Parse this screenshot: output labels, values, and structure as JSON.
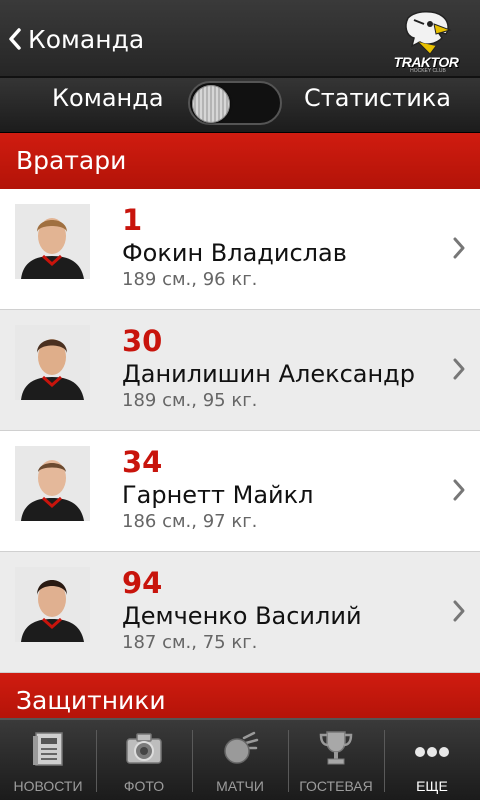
{
  "header": {
    "back_label": "Команда",
    "logo_text": "TRAKTOR",
    "logo_subtext": "HOCKEY CLUB"
  },
  "segmented": {
    "left_label": "Команда",
    "right_label": "Статистика"
  },
  "sections": [
    {
      "title": "Вратари",
      "players": [
        {
          "number": "1",
          "name": "Фокин Владислав",
          "meta": "189 см., 96 кг."
        },
        {
          "number": "30",
          "name": "Данилишин Александр",
          "meta": "189 см., 95 кг."
        },
        {
          "number": "34",
          "name": "Гарнетт Майкл",
          "meta": "186 см., 97 кг."
        },
        {
          "number": "94",
          "name": "Демченко Василий",
          "meta": "187 см., 75 кг."
        }
      ]
    },
    {
      "title": "Защитники"
    }
  ],
  "tabbar": {
    "tabs": [
      {
        "label": "НОВОСТИ",
        "icon": "newspaper-icon"
      },
      {
        "label": "ФОТО",
        "icon": "camera-icon"
      },
      {
        "label": "МАТЧИ",
        "icon": "puck-icon"
      },
      {
        "label": "ГОСТЕВАЯ",
        "icon": "trophy-icon"
      },
      {
        "label": "ЕЩЕ",
        "icon": "more-icon"
      }
    ],
    "active_index": 4
  },
  "colors": {
    "accent": "#c8140c",
    "header_bg": "#2e2e2e",
    "row_alt_bg": "#ececec"
  }
}
